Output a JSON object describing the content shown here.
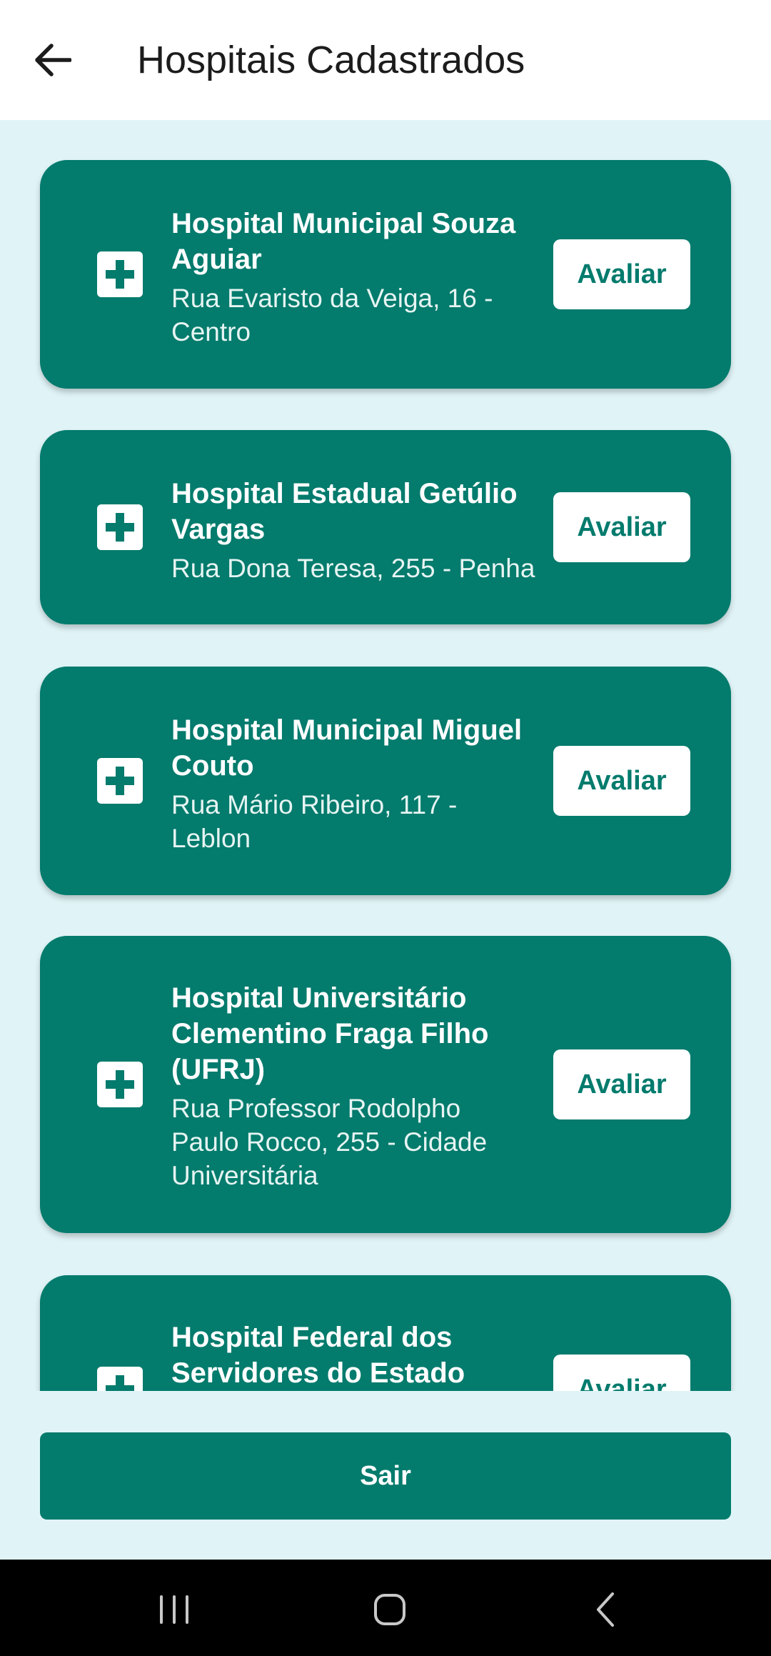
{
  "header": {
    "title": "Hospitais Cadastrados",
    "back_icon": "arrow-left-icon"
  },
  "hospitals": [
    {
      "name": "Hospital Municipal Souza Aguiar",
      "address": "Rua Evaristo da Veiga, 16 -\nCentro",
      "button_label": "Avaliar",
      "icon": "medical-cross-icon"
    },
    {
      "name": "Hospital Estadual Getúlio Vargas",
      "address": "Rua Dona Teresa, 255 - Penha",
      "button_label": "Avaliar",
      "icon": "medical-cross-icon"
    },
    {
      "name": "Hospital Municipal Miguel Couto",
      "address": "Rua Mário Ribeiro, 117 -\nLeblon",
      "button_label": "Avaliar",
      "icon": "medical-cross-icon"
    },
    {
      "name": "Hospital Universitário Clementino Fraga Filho (UFRJ)",
      "address": "Rua Professor Rodolpho\nPaulo Rocco, 255 - Cidade\nUniversitária",
      "button_label": "Avaliar",
      "icon": "medical-cross-icon"
    },
    {
      "name": "Hospital Federal dos Servidores do Estado",
      "address": "",
      "button_label": "Avaliar",
      "icon": "medical-cross-icon"
    }
  ],
  "footer": {
    "exit_label": "Sair"
  },
  "system_nav": {
    "recents_icon": "recents-icon",
    "home_icon": "home-icon",
    "back_icon": "system-back-icon"
  },
  "colors": {
    "primary": "#037b6d",
    "background": "#e0f4f7",
    "appbar": "#ffffff",
    "navbar": "#000000"
  }
}
